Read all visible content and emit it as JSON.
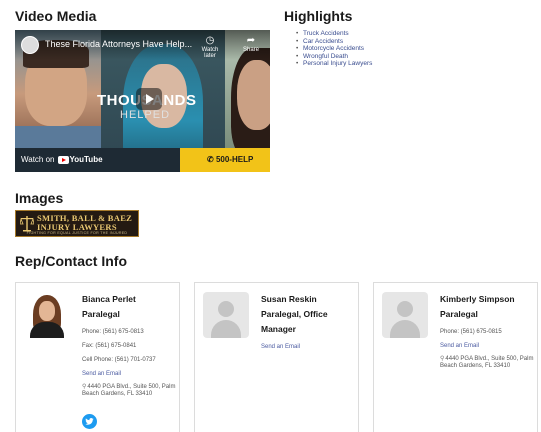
{
  "sections": {
    "video": "Video Media",
    "highlights": "Highlights",
    "images": "Images",
    "contact": "Rep/Contact Info"
  },
  "video": {
    "title": "These Florida Attorneys Have Help...",
    "watch_later": "Watch later",
    "share": "Share",
    "headline": "THOUSANDS",
    "subheadline": "HELPED",
    "watch_on": "Watch on",
    "youtube": "YouTube",
    "phone_cta": "500-HELP",
    "icons": [
      "clock-icon",
      "share-arrow-icon",
      "play-icon",
      "phone-icon",
      "youtube-logo-icon"
    ]
  },
  "highlights": {
    "items": [
      "Truck Accidents",
      "Car Accidents",
      "Motorcycle Accidents",
      "Wrongful Death",
      "Personal Injury Lawyers"
    ]
  },
  "logo": {
    "line1": "SMITH, BALL & BAEZ",
    "line2": "INJURY LAWYERS",
    "tagline": "FIGHTING FOR EQUAL JUSTICE FOR THE INJURED"
  },
  "contacts": [
    {
      "name": "Bianca Perlet",
      "title": "Paralegal",
      "phone": "Phone: (561) 675-0813",
      "fax": "Fax: (561) 675-0841",
      "cell": "Cell Phone: (561) 701-0737",
      "email_link": "Send an Email",
      "address": "4440 PGA Blvd., Suite 500, Palm Beach Gardens, FL 33410",
      "has_photo": true
    },
    {
      "name": "Susan Reskin",
      "title": "Paralegal, Office Manager",
      "email_link": "Send an Email",
      "has_photo": false
    },
    {
      "name": "Kimberly Simpson",
      "title": "Paralegal",
      "phone": "Phone: (561) 675-0815",
      "email_link": "Send an Email",
      "address": "4440 PGA Blvd., Suite 500, Palm Beach Gardens, FL 33410",
      "has_photo": false
    }
  ],
  "colors": {
    "link": "#4a5aa0",
    "cta_gold": "#f2c318",
    "twitter": "#1d9bf0"
  }
}
